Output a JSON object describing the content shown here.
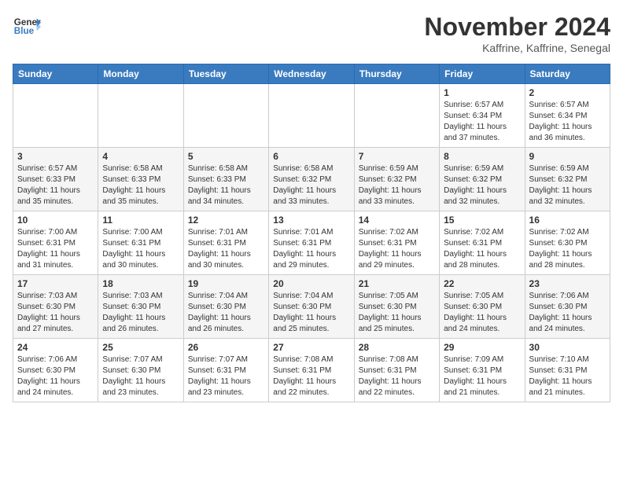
{
  "header": {
    "logo_line1": "General",
    "logo_line2": "Blue",
    "month": "November 2024",
    "location": "Kaffrine, Kaffrine, Senegal"
  },
  "weekdays": [
    "Sunday",
    "Monday",
    "Tuesday",
    "Wednesday",
    "Thursday",
    "Friday",
    "Saturday"
  ],
  "weeks": [
    [
      {
        "day": "",
        "info": ""
      },
      {
        "day": "",
        "info": ""
      },
      {
        "day": "",
        "info": ""
      },
      {
        "day": "",
        "info": ""
      },
      {
        "day": "",
        "info": ""
      },
      {
        "day": "1",
        "info": "Sunrise: 6:57 AM\nSunset: 6:34 PM\nDaylight: 11 hours\nand 37 minutes."
      },
      {
        "day": "2",
        "info": "Sunrise: 6:57 AM\nSunset: 6:34 PM\nDaylight: 11 hours\nand 36 minutes."
      }
    ],
    [
      {
        "day": "3",
        "info": "Sunrise: 6:57 AM\nSunset: 6:33 PM\nDaylight: 11 hours\nand 35 minutes."
      },
      {
        "day": "4",
        "info": "Sunrise: 6:58 AM\nSunset: 6:33 PM\nDaylight: 11 hours\nand 35 minutes."
      },
      {
        "day": "5",
        "info": "Sunrise: 6:58 AM\nSunset: 6:33 PM\nDaylight: 11 hours\nand 34 minutes."
      },
      {
        "day": "6",
        "info": "Sunrise: 6:58 AM\nSunset: 6:32 PM\nDaylight: 11 hours\nand 33 minutes."
      },
      {
        "day": "7",
        "info": "Sunrise: 6:59 AM\nSunset: 6:32 PM\nDaylight: 11 hours\nand 33 minutes."
      },
      {
        "day": "8",
        "info": "Sunrise: 6:59 AM\nSunset: 6:32 PM\nDaylight: 11 hours\nand 32 minutes."
      },
      {
        "day": "9",
        "info": "Sunrise: 6:59 AM\nSunset: 6:32 PM\nDaylight: 11 hours\nand 32 minutes."
      }
    ],
    [
      {
        "day": "10",
        "info": "Sunrise: 7:00 AM\nSunset: 6:31 PM\nDaylight: 11 hours\nand 31 minutes."
      },
      {
        "day": "11",
        "info": "Sunrise: 7:00 AM\nSunset: 6:31 PM\nDaylight: 11 hours\nand 30 minutes."
      },
      {
        "day": "12",
        "info": "Sunrise: 7:01 AM\nSunset: 6:31 PM\nDaylight: 11 hours\nand 30 minutes."
      },
      {
        "day": "13",
        "info": "Sunrise: 7:01 AM\nSunset: 6:31 PM\nDaylight: 11 hours\nand 29 minutes."
      },
      {
        "day": "14",
        "info": "Sunrise: 7:02 AM\nSunset: 6:31 PM\nDaylight: 11 hours\nand 29 minutes."
      },
      {
        "day": "15",
        "info": "Sunrise: 7:02 AM\nSunset: 6:31 PM\nDaylight: 11 hours\nand 28 minutes."
      },
      {
        "day": "16",
        "info": "Sunrise: 7:02 AM\nSunset: 6:30 PM\nDaylight: 11 hours\nand 28 minutes."
      }
    ],
    [
      {
        "day": "17",
        "info": "Sunrise: 7:03 AM\nSunset: 6:30 PM\nDaylight: 11 hours\nand 27 minutes."
      },
      {
        "day": "18",
        "info": "Sunrise: 7:03 AM\nSunset: 6:30 PM\nDaylight: 11 hours\nand 26 minutes."
      },
      {
        "day": "19",
        "info": "Sunrise: 7:04 AM\nSunset: 6:30 PM\nDaylight: 11 hours\nand 26 minutes."
      },
      {
        "day": "20",
        "info": "Sunrise: 7:04 AM\nSunset: 6:30 PM\nDaylight: 11 hours\nand 25 minutes."
      },
      {
        "day": "21",
        "info": "Sunrise: 7:05 AM\nSunset: 6:30 PM\nDaylight: 11 hours\nand 25 minutes."
      },
      {
        "day": "22",
        "info": "Sunrise: 7:05 AM\nSunset: 6:30 PM\nDaylight: 11 hours\nand 24 minutes."
      },
      {
        "day": "23",
        "info": "Sunrise: 7:06 AM\nSunset: 6:30 PM\nDaylight: 11 hours\nand 24 minutes."
      }
    ],
    [
      {
        "day": "24",
        "info": "Sunrise: 7:06 AM\nSunset: 6:30 PM\nDaylight: 11 hours\nand 24 minutes."
      },
      {
        "day": "25",
        "info": "Sunrise: 7:07 AM\nSunset: 6:30 PM\nDaylight: 11 hours\nand 23 minutes."
      },
      {
        "day": "26",
        "info": "Sunrise: 7:07 AM\nSunset: 6:31 PM\nDaylight: 11 hours\nand 23 minutes."
      },
      {
        "day": "27",
        "info": "Sunrise: 7:08 AM\nSunset: 6:31 PM\nDaylight: 11 hours\nand 22 minutes."
      },
      {
        "day": "28",
        "info": "Sunrise: 7:08 AM\nSunset: 6:31 PM\nDaylight: 11 hours\nand 22 minutes."
      },
      {
        "day": "29",
        "info": "Sunrise: 7:09 AM\nSunset: 6:31 PM\nDaylight: 11 hours\nand 21 minutes."
      },
      {
        "day": "30",
        "info": "Sunrise: 7:10 AM\nSunset: 6:31 PM\nDaylight: 11 hours\nand 21 minutes."
      }
    ]
  ]
}
